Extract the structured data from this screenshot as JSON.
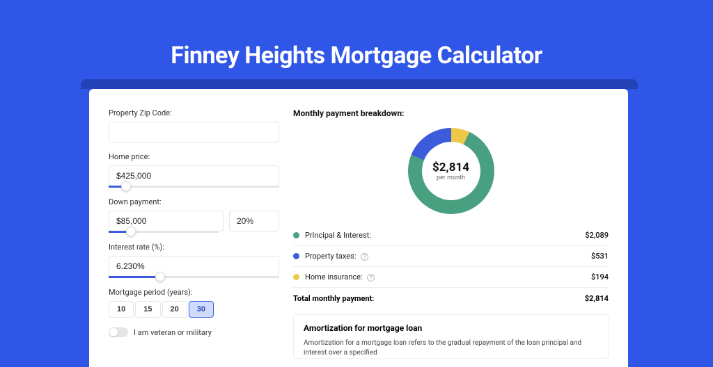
{
  "title": "Finney Heights Mortgage Calculator",
  "form": {
    "zip_label": "Property Zip Code:",
    "zip_value": "",
    "price_label": "Home price:",
    "price_value": "$425,000",
    "price_slider_pct": 10,
    "dp_label": "Down payment:",
    "dp_value": "$85,000",
    "dp_pct_value": "20%",
    "dp_slider_pct": 20,
    "rate_label": "Interest rate (%):",
    "rate_value": "6.230%",
    "rate_slider_pct": 30,
    "period_label": "Mortgage period (years):",
    "periods": [
      "10",
      "15",
      "20",
      "30"
    ],
    "period_active": "30",
    "veteran_label": "I am veteran or military"
  },
  "breakdown": {
    "title": "Monthly payment breakdown:",
    "donut_amount": "$2,814",
    "donut_label": "per month",
    "items": [
      {
        "color": "green",
        "label": "Principal & Interest:",
        "help": false,
        "value": "$2,089"
      },
      {
        "color": "blue",
        "label": "Property taxes:",
        "help": true,
        "value": "$531"
      },
      {
        "color": "yellow",
        "label": "Home insurance:",
        "help": true,
        "value": "$194"
      }
    ],
    "total_label": "Total monthly payment:",
    "total_value": "$2,814"
  },
  "amort": {
    "title": "Amortization for mortgage loan",
    "text": "Amortization for a mortgage loan refers to the gradual repayment of the loan principal and interest over a specified"
  },
  "colors": {
    "bg": "#3056e8",
    "green": "#48a080",
    "blue": "#3b5bdb",
    "yellow": "#edc94a"
  },
  "chart_data": {
    "type": "pie",
    "title": "Monthly payment breakdown",
    "series": [
      {
        "name": "Principal & Interest",
        "value": 2089,
        "color": "#48a080"
      },
      {
        "name": "Property taxes",
        "value": 531,
        "color": "#3b5bdb"
      },
      {
        "name": "Home insurance",
        "value": 194,
        "color": "#edc94a"
      }
    ],
    "total": 2814,
    "unit": "USD/month"
  }
}
